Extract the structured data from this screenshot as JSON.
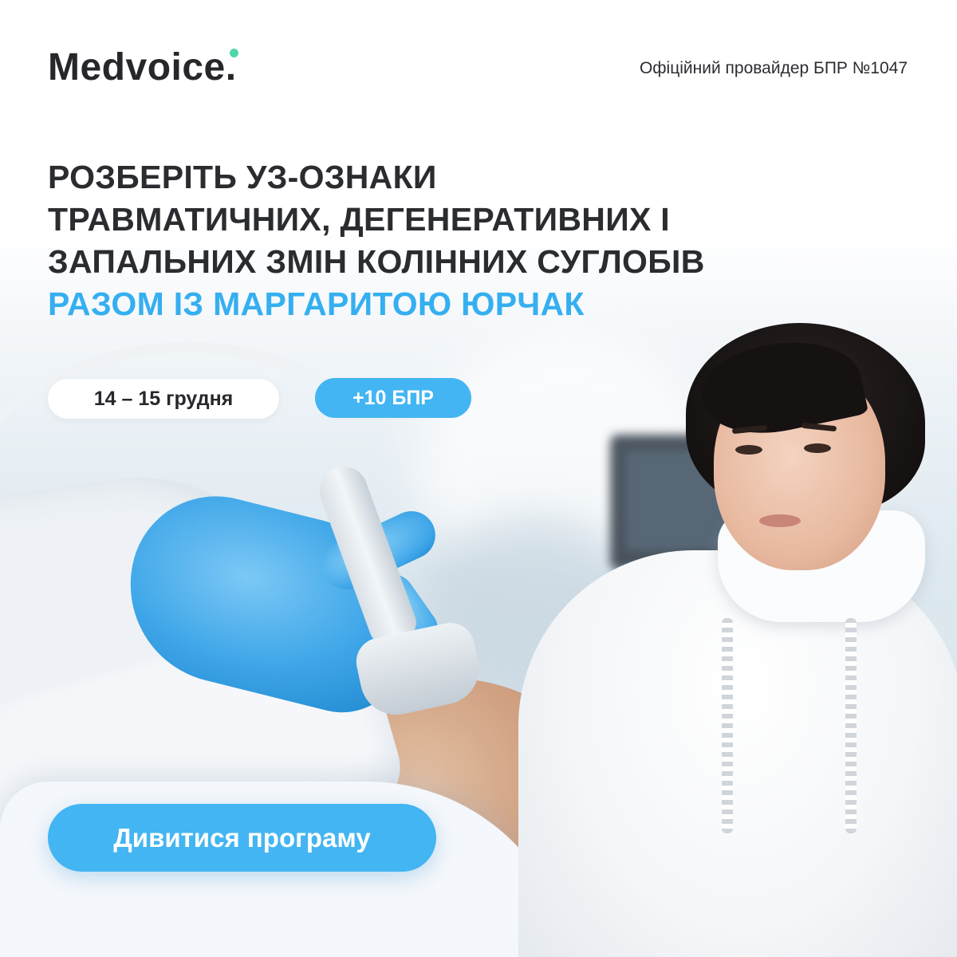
{
  "brand": {
    "logo_text": "Medvoice",
    "logo_dot_color": "#4fd6a8"
  },
  "header": {
    "provider_text": "Офіційний провайдер БПР №1047"
  },
  "headline": {
    "line1": "РОЗБЕРІТЬ УЗ-ОЗНАКИ",
    "line2": "ТРАВМАТИЧНИХ, ДЕГЕНЕРАТИВНИХ І",
    "line3": "ЗАПАЛЬНИХ ЗМІН КОЛІННИХ СУГЛОБІВ",
    "accent_line": "РАЗОМ ІЗ МАРГАРИТОЮ ЮРЧАК"
  },
  "badges": {
    "dates": "14 – 15 грудня",
    "bpr": "+10 БПР"
  },
  "cta": {
    "label": "Дивитися програму"
  },
  "colors": {
    "accent": "#43b5f2",
    "text_dark": "#2a2c30",
    "background": "#ffffff"
  },
  "illustration": {
    "left": "ultrasound-probe-on-knee-with-blue-glove",
    "right": "speaker-portrait"
  }
}
